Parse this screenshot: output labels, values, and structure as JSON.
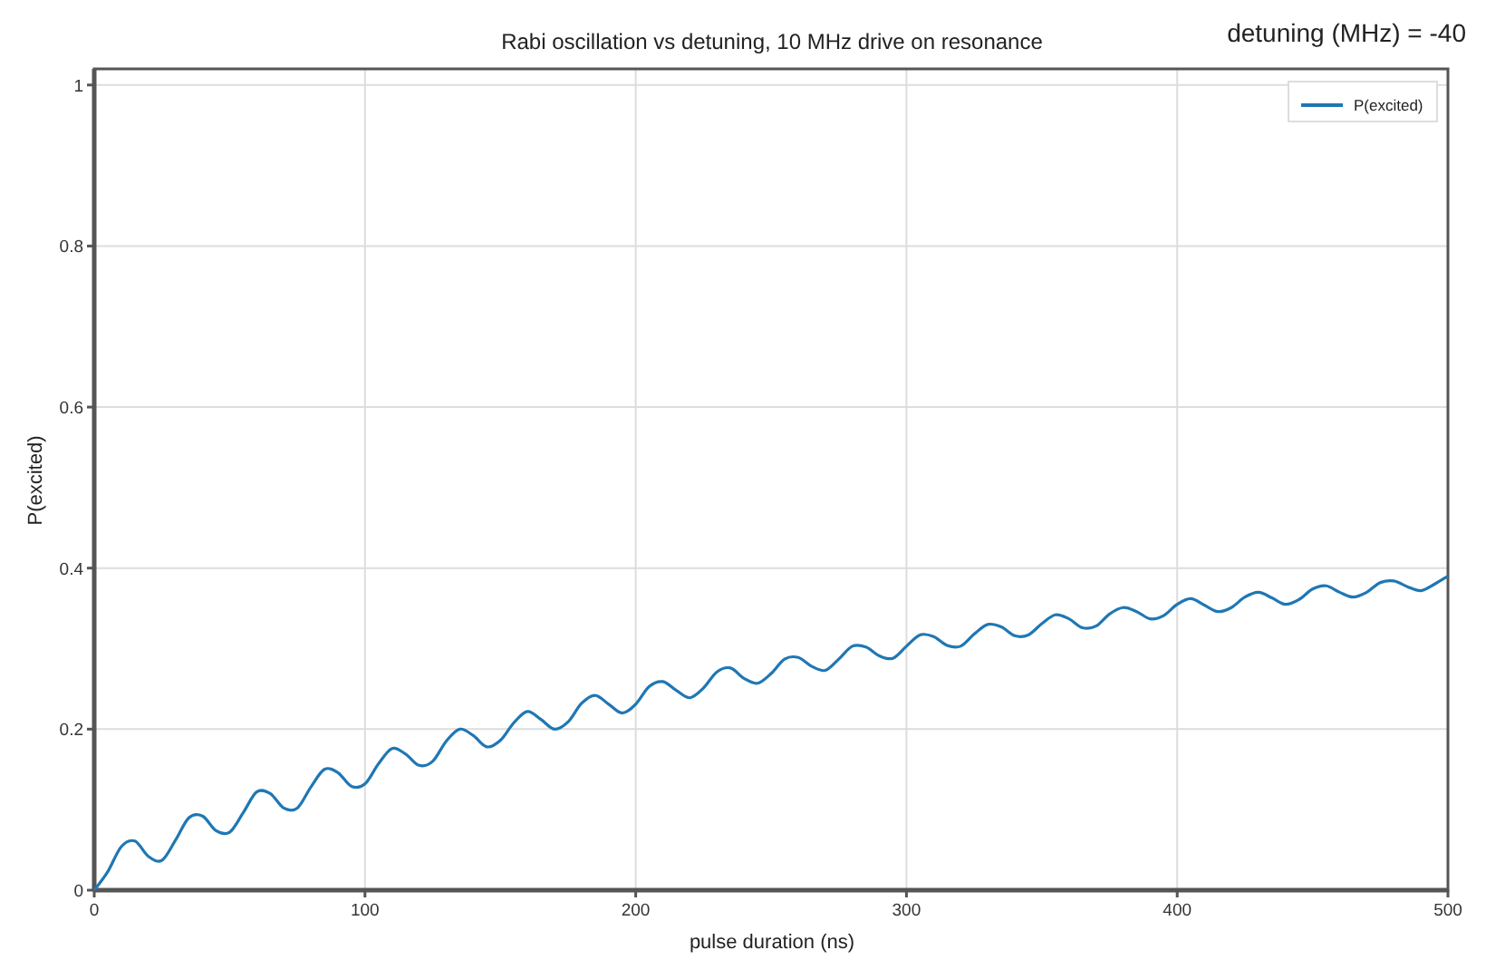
{
  "annotation": "detuning (MHz) = -40",
  "chart_data": {
    "type": "line",
    "title": "Rabi oscillation vs detuning, 10 MHz drive on resonance",
    "xlabel": "pulse duration (ns)",
    "ylabel": "P(excited)",
    "x": [
      0,
      5,
      10,
      15,
      20,
      25,
      30,
      35,
      40,
      45,
      50,
      55,
      60,
      65,
      70,
      75,
      80,
      85,
      90,
      95,
      100,
      105,
      110,
      115,
      120,
      125,
      130,
      135,
      140,
      145,
      150,
      155,
      160,
      165,
      170,
      175,
      180,
      185,
      190,
      195,
      200,
      205,
      210,
      215,
      220,
      225,
      230,
      235,
      240,
      245,
      250,
      255,
      260,
      265,
      270,
      275,
      280,
      285,
      290,
      295,
      300,
      305,
      310,
      315,
      320,
      325,
      330,
      335,
      340,
      345,
      350,
      355,
      360,
      365,
      370,
      375,
      380,
      385,
      390,
      395,
      400,
      405,
      410,
      415,
      420,
      425,
      430,
      435,
      440,
      445,
      450,
      455,
      460,
      465,
      470,
      475,
      480,
      485,
      490,
      495,
      500
    ],
    "series": [
      {
        "name": "P(excited)",
        "color": "#1f77b4",
        "values": [
          0,
          0.023,
          0.054,
          0.061,
          0.042,
          0.037,
          0.062,
          0.09,
          0.092,
          0.074,
          0.072,
          0.096,
          0.122,
          0.12,
          0.102,
          0.102,
          0.128,
          0.15,
          0.146,
          0.129,
          0.132,
          0.157,
          0.176,
          0.169,
          0.155,
          0.16,
          0.185,
          0.2,
          0.192,
          0.178,
          0.186,
          0.208,
          0.222,
          0.212,
          0.2,
          0.209,
          0.232,
          0.242,
          0.231,
          0.22,
          0.231,
          0.253,
          0.259,
          0.248,
          0.239,
          0.251,
          0.271,
          0.276,
          0.263,
          0.257,
          0.269,
          0.287,
          0.289,
          0.278,
          0.273,
          0.287,
          0.303,
          0.302,
          0.291,
          0.288,
          0.303,
          0.317,
          0.315,
          0.304,
          0.303,
          0.318,
          0.33,
          0.327,
          0.316,
          0.317,
          0.331,
          0.342,
          0.337,
          0.326,
          0.328,
          0.343,
          0.351,
          0.346,
          0.337,
          0.341,
          0.355,
          0.362,
          0.354,
          0.346,
          0.351,
          0.364,
          0.37,
          0.363,
          0.355,
          0.361,
          0.374,
          0.378,
          0.37,
          0.364,
          0.37,
          0.382,
          0.384,
          0.377,
          0.372,
          0.38,
          0.39
        ]
      }
    ],
    "grid": true,
    "xlim": [
      0,
      500
    ],
    "ylim": [
      0,
      1.02
    ],
    "xticks": [
      0,
      100,
      200,
      300,
      400,
      500
    ],
    "yticks": [
      0,
      0.2,
      0.4,
      0.6,
      0.8,
      1
    ]
  }
}
